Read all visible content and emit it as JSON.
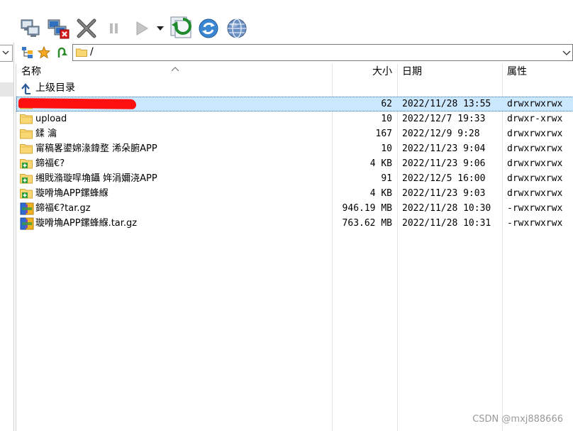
{
  "toolbar": {
    "buttons": [
      {
        "name": "connect-icon"
      },
      {
        "name": "disconnect-icon"
      },
      {
        "name": "delete-icon"
      },
      {
        "name": "pause-icon"
      },
      {
        "name": "play-icon"
      },
      {
        "name": "dropdown-arrow-icon"
      },
      {
        "name": "sync-icon"
      },
      {
        "name": "refresh-icon"
      },
      {
        "name": "globe-icon"
      }
    ]
  },
  "address_bar": {
    "path": "/"
  },
  "file_list": {
    "columns": {
      "name": "名称",
      "size": "大小",
      "date": "日期",
      "attr": "属性"
    },
    "parent_dir_label": "上级目录",
    "rows": [
      {
        "name": "",
        "redacted": true,
        "size": "62",
        "date": "2022/11/28 13:55",
        "attr": "drwxrwxrwx",
        "type": "folder"
      },
      {
        "name": "upload",
        "size": "10",
        "date": "2022/12/7 19:33",
        "attr": "drwxr-xrwx",
        "type": "folder"
      },
      {
        "name": "鍒  瀹",
        "size": "167",
        "date": "2022/12/9 9:28",
        "attr": "drwxrwxrwx",
        "type": "folder"
      },
      {
        "name": "甯稿畧鍙婂湪鍏堥  浠朵腑APP",
        "size": "10",
        "date": "2022/11/23 9:04",
        "attr": "drwxrwxrwx",
        "type": "folder"
      },
      {
        "name": "鍗福€?",
        "size": "4 KB",
        "date": "2022/11/23 9:06",
        "attr": "drwxrwxrwx",
        "type": "folder-plus"
      },
      {
        "name": "缃戝潃璇哻埆鑷  姩涓嬭浇APP",
        "size": "91",
        "date": "2022/12/5 16:00",
        "attr": "drwxrwxrwx",
        "type": "folder-plus"
      },
      {
        "name": "璇嗗埆APP鏍蜂緥",
        "size": "4 KB",
        "date": "2022/11/23 9:03",
        "attr": "drwxrwxrwx",
        "type": "folder-plus"
      },
      {
        "name": "鍗福€?tar.gz",
        "size": "946.19 MB",
        "date": "2022/11/28 10:30",
        "attr": "-rwxrwxrwx",
        "type": "archive"
      },
      {
        "name": "璇嗗埆APP鏍蜂緥.tar.gz",
        "size": "763.62 MB",
        "date": "2022/11/28 10:31",
        "attr": "-rwxrwxrwx",
        "type": "archive"
      }
    ]
  },
  "watermark": "CSDN @mxj888666"
}
